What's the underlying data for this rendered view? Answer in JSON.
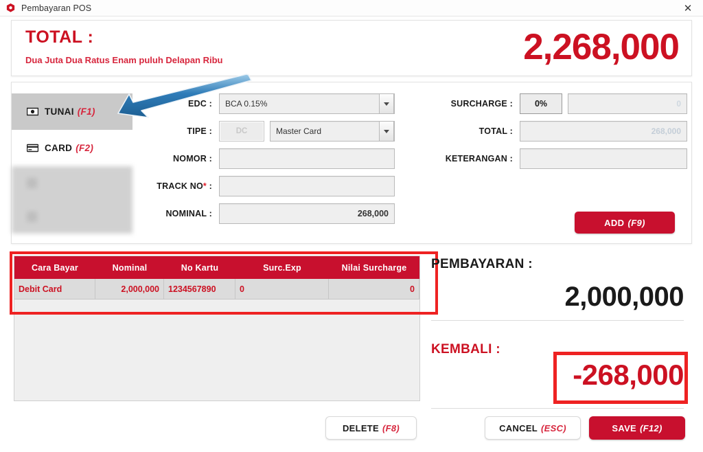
{
  "window": {
    "title": "Pembayaran POS",
    "app_icon": "hexagon-app-icon",
    "close_label": "✕"
  },
  "header": {
    "total_label": "TOTAL :",
    "total_words": "Dua Juta Dua Ratus Enam puluh Delapan Ribu",
    "total_amount": "2,268,000",
    "accent_color": "#cc1122"
  },
  "methods": [
    {
      "label": "TUNAI",
      "hotkey": "(F1)",
      "icon": "banknote-icon",
      "state": "active"
    },
    {
      "label": "CARD",
      "hotkey": "(F2)",
      "icon": "credit-card-icon",
      "state": "normal"
    }
  ],
  "form": {
    "edc": {
      "label": "EDC :",
      "value": "BCA 0.15%"
    },
    "tipe": {
      "label": "TIPE :",
      "button_value": "DC",
      "value": "Master Card"
    },
    "nomor": {
      "label": "NOMOR :",
      "value": ""
    },
    "track_no": {
      "label": "TRACK NO",
      "required_mark": "*",
      "suffix": " :",
      "value": ""
    },
    "nominal": {
      "label": "NOMINAL :",
      "value": "268,000"
    },
    "surcharge": {
      "label": "SURCHARGE :",
      "percent": "0%",
      "value": "0"
    },
    "total": {
      "label": "TOTAL :",
      "value": "268,000"
    },
    "keterangan": {
      "label": "KETERANGAN :",
      "value": ""
    },
    "add_button": {
      "label": "ADD",
      "hotkey": "(F9)"
    }
  },
  "table": {
    "headers": [
      "Cara Bayar",
      "Nominal",
      "No Kartu",
      "Surc.Exp",
      "Nilai Surcharge"
    ],
    "rows": [
      {
        "cara_bayar": "Debit Card",
        "nominal": "2,000,000",
        "no_kartu": "1234567890",
        "surc_exp": "0",
        "nilai_surcharge": "0"
      }
    ]
  },
  "summary": {
    "pembayaran_label": "PEMBAYARAN :",
    "pembayaran_value": "2,000,000",
    "kembali_label": "KEMBALI :",
    "kembali_value": "-268,000"
  },
  "actions": {
    "delete": {
      "label": "DELETE",
      "hotkey": "(F8)"
    },
    "cancel": {
      "label": "CANCEL",
      "hotkey": "(ESC)"
    },
    "save": {
      "label": "SAVE",
      "hotkey": "(F12)"
    }
  },
  "annotations": {
    "arrow": "blue-arrow-pointing-to-tunai",
    "box_table": "red-highlight-box-payment-table",
    "box_kembali": "red-highlight-box-kembali"
  }
}
